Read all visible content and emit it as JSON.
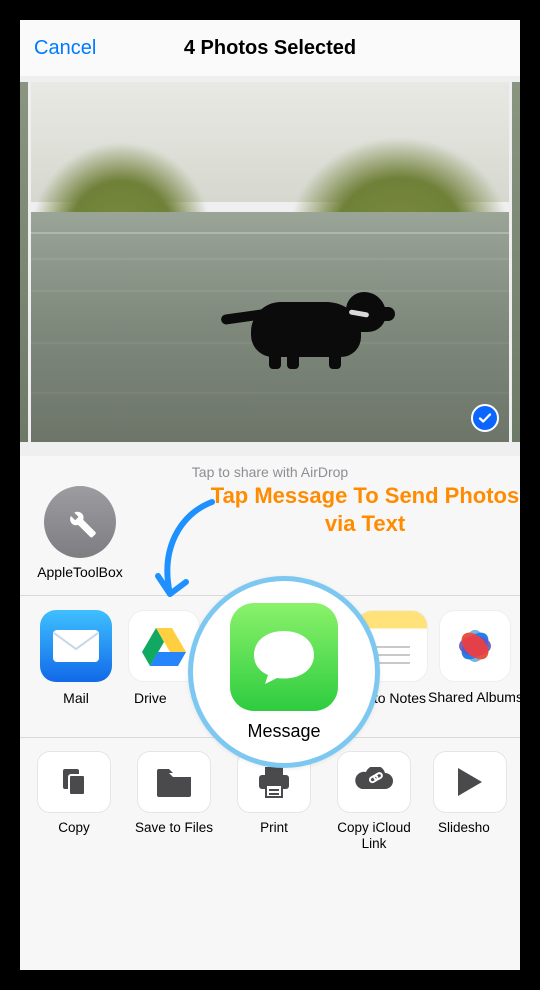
{
  "header": {
    "cancel": "Cancel",
    "title": "4 Photos Selected"
  },
  "airdrop": {
    "hint": "Tap to share with AirDrop",
    "items": [
      {
        "label": "AppleToolBox",
        "icon": "wrench-icon"
      }
    ]
  },
  "callout": {
    "text": "Tap Message To Send Photos via Text"
  },
  "highlight": {
    "label": "Message",
    "icon": "message-bubble-icon"
  },
  "apps": [
    {
      "label": "Mail",
      "icon": "mail-icon"
    },
    {
      "label": "Drive",
      "icon": "drive-icon"
    },
    {
      "label_visible": "to Notes",
      "icon": "notes-icon"
    },
    {
      "label_visible": "Shared Albums",
      "icon": "photos-icon"
    }
  ],
  "actions": [
    {
      "label": "Copy",
      "icon": "copy-icon"
    },
    {
      "label": "Save to Files",
      "icon": "folder-icon"
    },
    {
      "label": "Print",
      "icon": "printer-icon"
    },
    {
      "label": "Copy iCloud Link",
      "icon": "cloud-link-icon"
    },
    {
      "label_visible": "Slidesho",
      "icon": "play-icon"
    }
  ],
  "colors": {
    "ios_blue": "#007aff",
    "callout_orange": "#ff8c00",
    "highlight_ring": "#7cc8f0",
    "check_blue": "#0a66ff"
  }
}
